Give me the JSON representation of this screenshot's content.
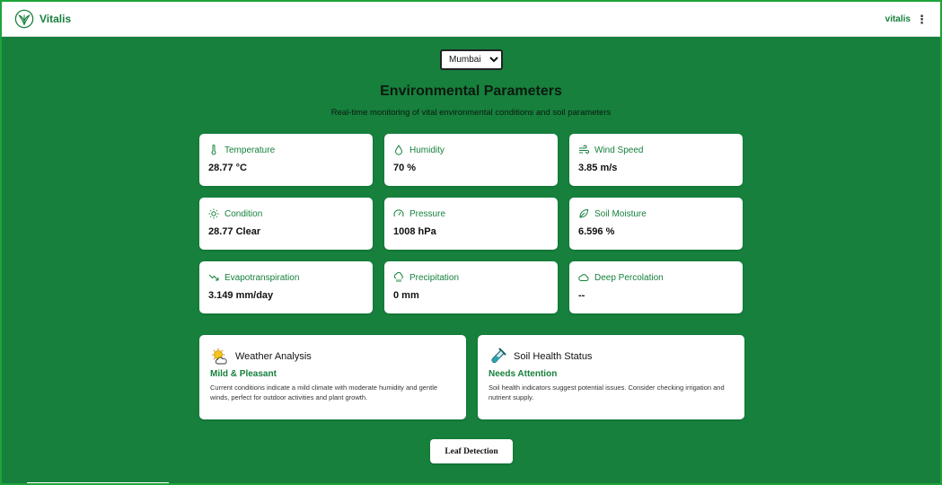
{
  "colors": {
    "accent": "#16803c",
    "background": "#16803c",
    "card": "#ffffff"
  },
  "header": {
    "brand": "Vitalis",
    "user": "vitalis",
    "logo_icon": "leaf-logo-icon",
    "menu_icon": "kebab-menu-icon"
  },
  "location": {
    "selected": "Mumbai",
    "options": [
      "Mumbai"
    ]
  },
  "main": {
    "title": "Environmental Parameters",
    "subtitle": "Real-time monitoring of vital environmental conditions and soil parameters"
  },
  "metrics": [
    {
      "label": "Temperature",
      "value": "28.77 °C",
      "icon": "thermometer-icon"
    },
    {
      "label": "Humidity",
      "value": "70 %",
      "icon": "droplet-icon"
    },
    {
      "label": "Wind Speed",
      "value": "3.85 m/s",
      "icon": "wind-icon"
    },
    {
      "label": "Condition",
      "value": "28.77 Clear",
      "icon": "sun-icon"
    },
    {
      "label": "Pressure",
      "value": "1008 hPa",
      "icon": "gauge-icon"
    },
    {
      "label": "Soil Moisture",
      "value": "6.596 %",
      "icon": "leaf-icon"
    },
    {
      "label": "Evapotranspiration",
      "value": "3.149 mm/day",
      "icon": "trending-down-icon"
    },
    {
      "label": "Precipitation",
      "value": "0 mm",
      "icon": "cloud-rain-icon"
    },
    {
      "label": "Deep Percolation",
      "value": "--",
      "icon": "cloud-icon"
    }
  ],
  "weather_panel": {
    "title": "Weather Analysis",
    "status": "Mild & Pleasant",
    "description": "Current conditions indicate a mild climate with moderate humidity and gentle winds, perfect for outdoor activities and plant growth.",
    "icon": "sun-cloud-icon"
  },
  "soil_panel": {
    "title": "Soil Health Status",
    "status": "Needs Attention",
    "description": "Soil health indicators suggest potential issues. Consider checking irrigation and nutrient supply.",
    "icon": "test-tube-icon"
  },
  "actions": {
    "leaf_detection": "Leaf Detection"
  }
}
